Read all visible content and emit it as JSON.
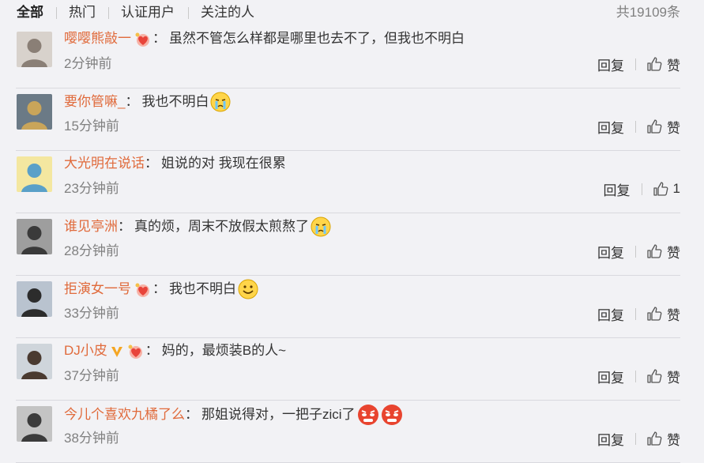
{
  "tabs": [
    "全部",
    "热门",
    "认证用户",
    "关注的人"
  ],
  "total_count": "共19109条",
  "reply_label": "回复",
  "like_label": "赞",
  "colors": {
    "username": "#e06a3b",
    "time": "#808080",
    "vip": "#f5a623",
    "badge": "#e8443a"
  },
  "comments": [
    {
      "user": "嘤嘤熊敲一",
      "badges": [
        "heart-badge-icon"
      ],
      "text": "虽然不管怎么样都是哪里也去不了，但我也不明白",
      "emoji": [],
      "time": "2分钟前",
      "likes": "赞"
    },
    {
      "user": "要你管嘛_",
      "badges": [],
      "text": "我也不明白",
      "emoji": [
        "crying-emoji-icon"
      ],
      "time": "15分钟前",
      "likes": "赞"
    },
    {
      "user": "大光明在说话",
      "badges": [],
      "text": "姐说的对 我现在很累",
      "emoji": [],
      "time": "23分钟前",
      "likes": "1"
    },
    {
      "user": "谁见亭洲",
      "badges": [],
      "text": "真的烦，周末不放假太煎熬了",
      "emoji": [
        "crying-emoji-icon"
      ],
      "time": "28分钟前",
      "likes": "赞"
    },
    {
      "user": "拒演女一号",
      "badges": [
        "heart-badge-icon"
      ],
      "text": "我也不明白",
      "emoji": [
        "smile-emoji-icon"
      ],
      "time": "33分钟前",
      "likes": "赞"
    },
    {
      "user": "DJ小皮",
      "badges": [
        "vip-v-icon",
        "heart-badge-icon"
      ],
      "text": "妈的，最烦装B的人~",
      "emoji": [],
      "time": "37分钟前",
      "likes": "赞"
    },
    {
      "user": "今儿个喜欢九橘了么",
      "badges": [],
      "text": "那姐说得对，一把子zici了",
      "emoji": [
        "angry-emoji-icon",
        "angry-emoji-icon"
      ],
      "time": "38分钟前",
      "likes": "赞"
    }
  ]
}
